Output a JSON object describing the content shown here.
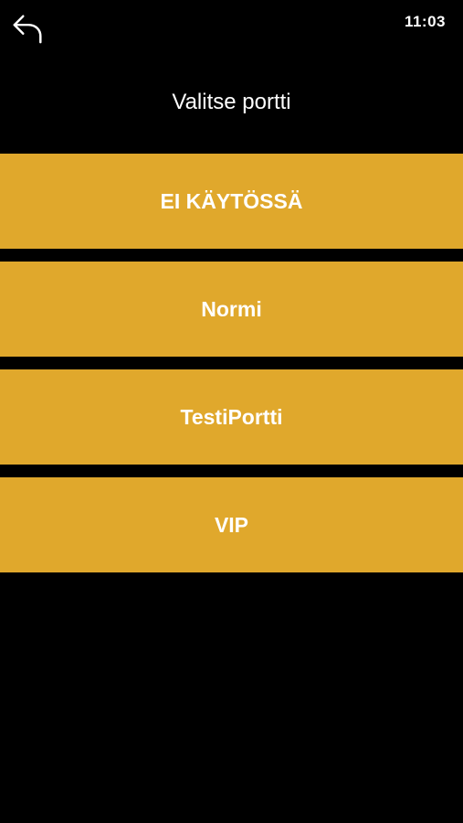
{
  "status_bar": {
    "time": "11:03"
  },
  "header": {
    "back_icon": "back-arrow-icon",
    "title": "Valitse portti"
  },
  "gates": [
    {
      "label": "EI KÄYTÖSSÄ"
    },
    {
      "label": "Normi"
    },
    {
      "label": "TestiPortti"
    },
    {
      "label": "VIP"
    }
  ],
  "colors": {
    "background": "#000000",
    "button": "#E0A82C",
    "text": "#FFFFFF"
  }
}
